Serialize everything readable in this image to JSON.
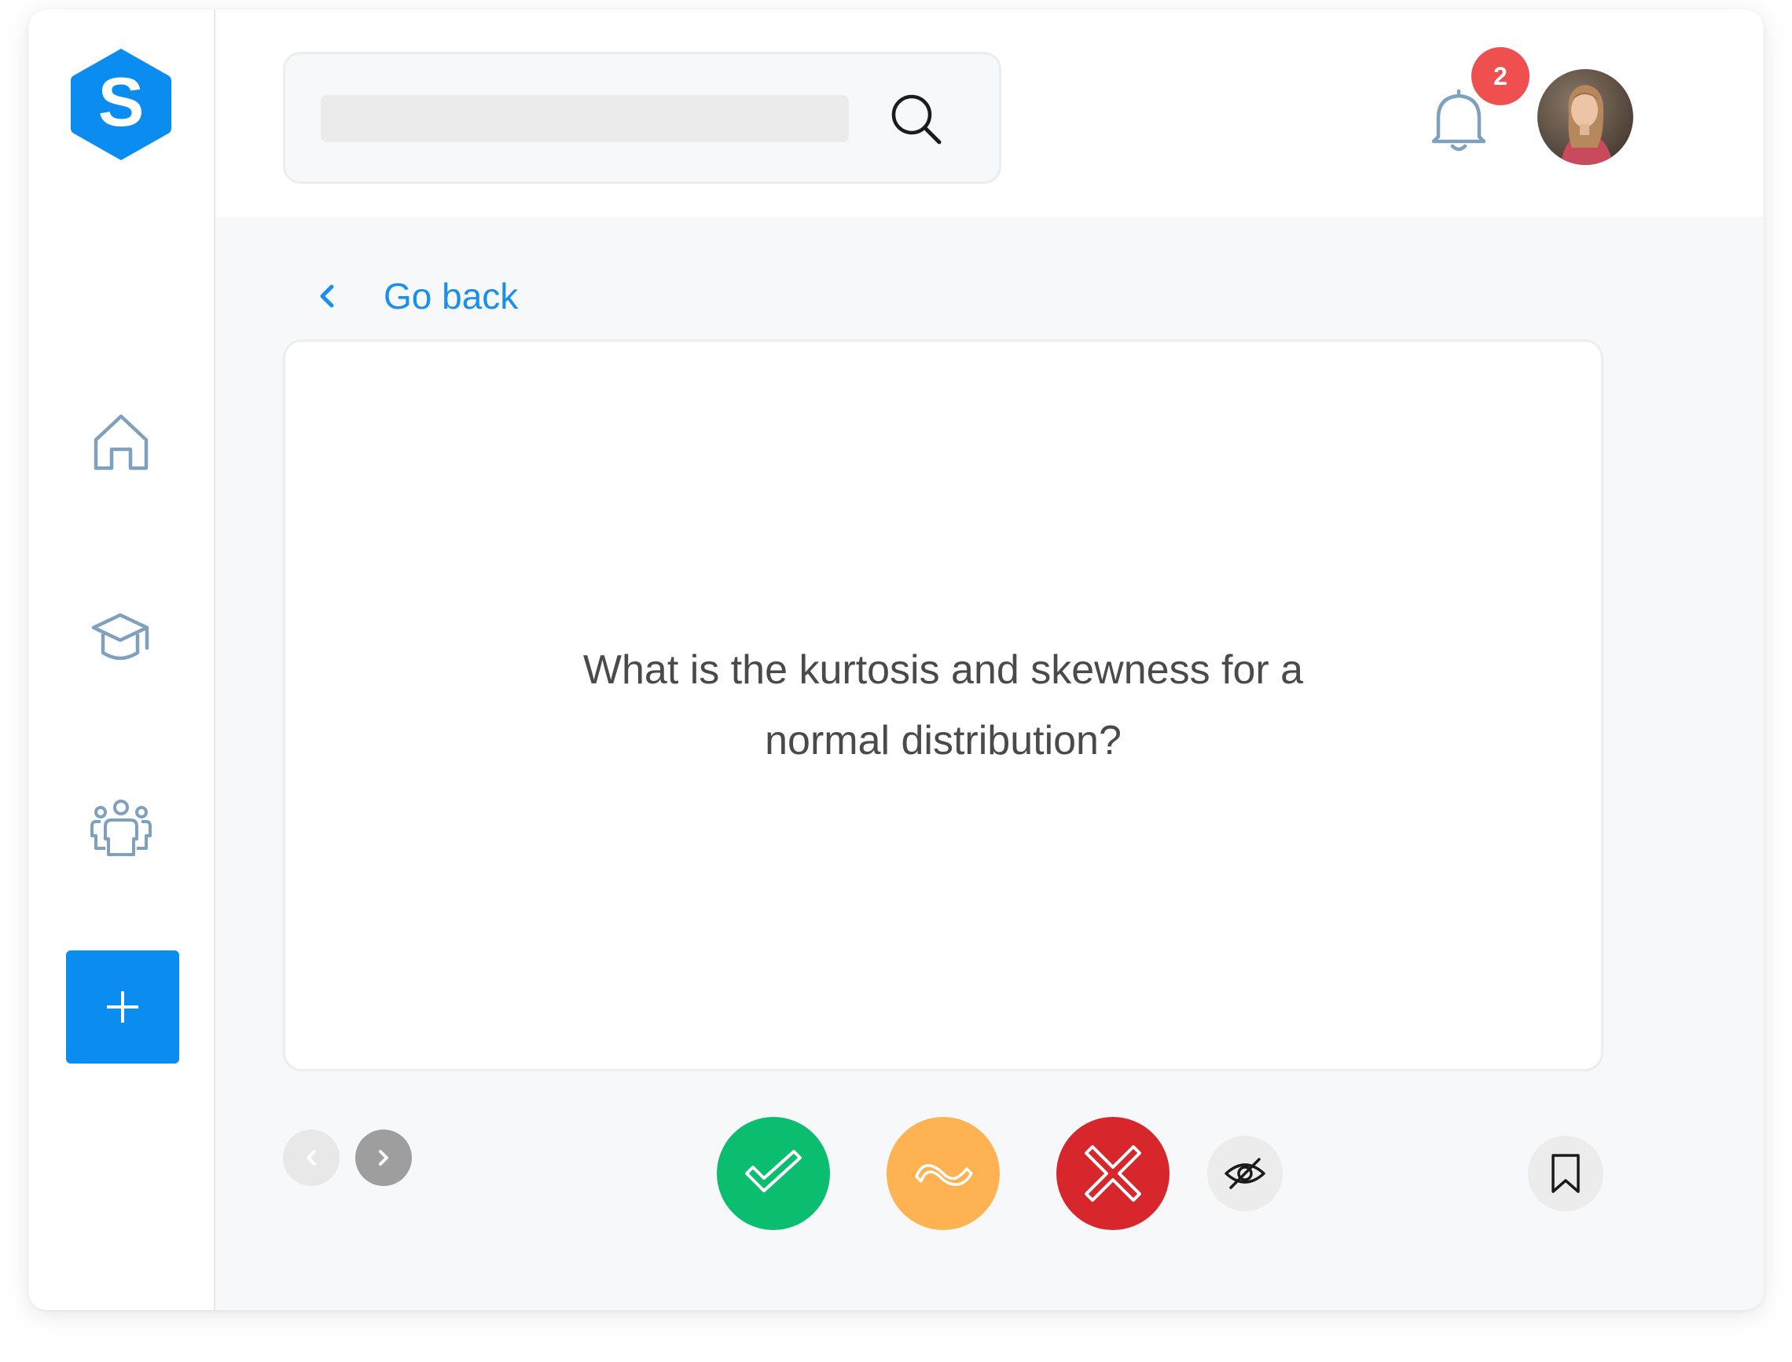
{
  "brand": {
    "logo_letter": "S",
    "accent_color": "#0a8cf0"
  },
  "sidebar": {
    "items": [
      {
        "name": "home",
        "icon": "home-icon"
      },
      {
        "name": "courses",
        "icon": "graduation-cap-icon"
      },
      {
        "name": "groups",
        "icon": "users-icon"
      }
    ],
    "add_button_icon": "plus-icon"
  },
  "header": {
    "search": {
      "value": "",
      "placeholder": "",
      "icon": "search-icon"
    },
    "notifications": {
      "icon": "bell-icon",
      "count": "2",
      "badge_color": "#ef4f4f"
    },
    "avatar": {
      "icon": "user-avatar"
    }
  },
  "nav": {
    "go_back_label": "Go back",
    "go_back_icon": "chevron-left-icon"
  },
  "flashcard": {
    "question": "What is the kurtosis and skewness for a normal distribution?"
  },
  "controls": {
    "prev_icon": "chevron-left-icon",
    "next_icon": "chevron-right-icon",
    "answers": [
      {
        "name": "correct",
        "icon": "check-icon",
        "color": "#0bbd6e"
      },
      {
        "name": "partial",
        "icon": "wave-icon",
        "color": "#ffb252"
      },
      {
        "name": "incorrect",
        "icon": "x-icon",
        "color": "#d8272c"
      }
    ],
    "hide_icon": "eye-off-icon",
    "bookmark_icon": "bookmark-icon"
  }
}
